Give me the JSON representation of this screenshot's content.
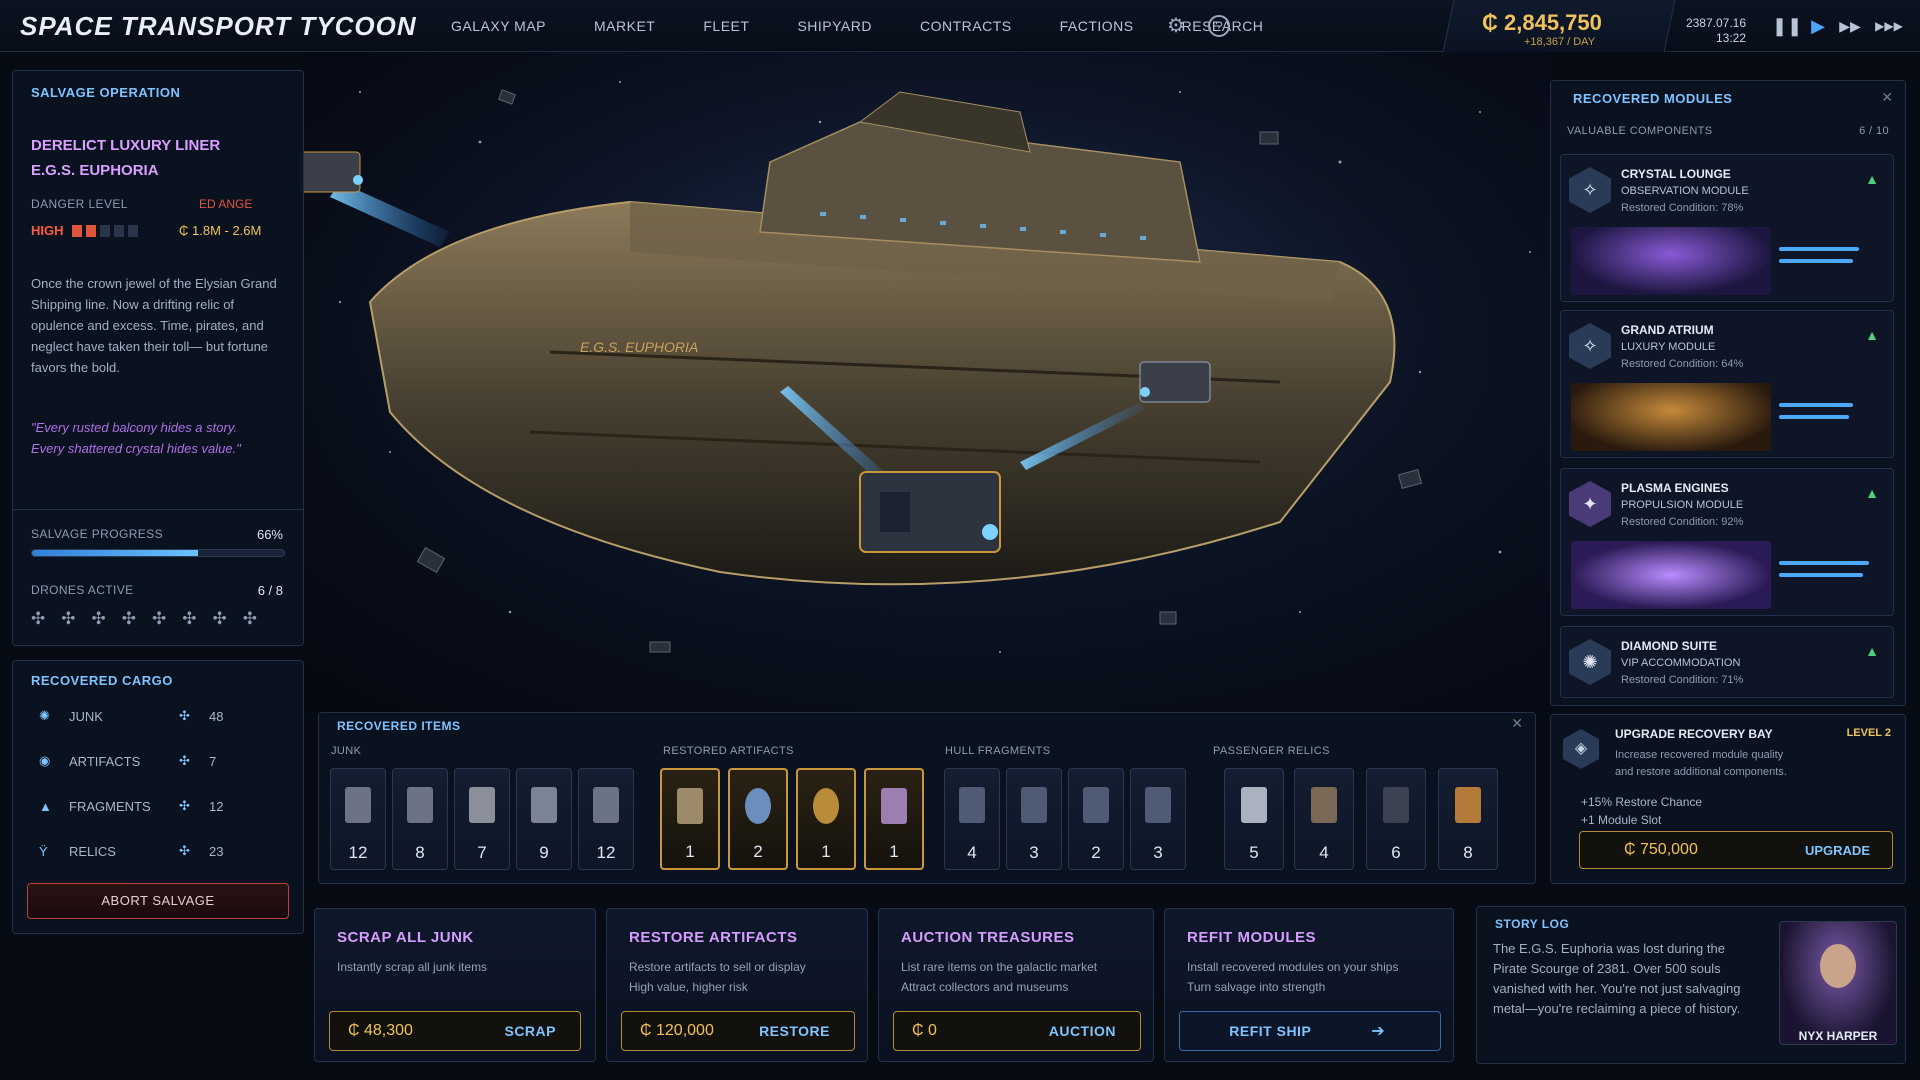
{
  "header": {
    "title": "SPACE TRANSPORT TYCOON",
    "nav": [
      "GALAXY MAP",
      "MARKET",
      "FLEET",
      "SHIPYARD",
      "CONTRACTS",
      "FACTIONS",
      "RESEARCH"
    ],
    "settings_icon": "gear-icon",
    "help_icon": "question-icon",
    "credits": "₵ 2,845,750",
    "income": "+18,367 / DAY",
    "date": "2387.07.16",
    "time": "13:22",
    "controls": [
      "pause-icon",
      "play-icon",
      "fast-forward-icon",
      "fastest-forward-icon"
    ]
  },
  "salvage": {
    "title": "SALVAGE OPERATION",
    "target_name": "DERELICT LUXURY LINER",
    "target_ship": "E.G.S. EUPHORIA",
    "danger_label": "DANGER LEVEL",
    "danger_value": "HIGH",
    "range_label": "ED ANGE",
    "range_value": "₵ 1.8M - 2.6M",
    "description": "Once the crown jewel of the Elysian Grand Shipping line. Now a drifting relic of opulence and excess. Time, pirates, and neglect have taken their toll— but fortune favors the bold.",
    "quote": "\"Every rusted balcony hides a story. Every shattered crystal hides value.\"",
    "progress_label": "SALVAGE PROGRESS",
    "progress_value": "66%",
    "progress_fraction": 0.66,
    "drones_label": "DRONES ACTIVE",
    "drones_value": "6 / 8"
  },
  "cargo": {
    "title": "RECOVERED CARGO",
    "rows": [
      {
        "label": "JUNK",
        "count": "48"
      },
      {
        "label": "ARTIFACTS",
        "count": "7"
      },
      {
        "label": "FRAGMENTS",
        "count": "12"
      },
      {
        "label": "RELICS",
        "count": "23"
      }
    ],
    "abort": "ABORT SALVAGE"
  },
  "items": {
    "title": "RECOVERED ITEMS",
    "groups": [
      "JUNK",
      "RESTORED ARTIFACTS",
      "HULL FRAGMENTS",
      "PASSENGER RELICS"
    ],
    "junk": [
      "12",
      "8",
      "7",
      "9",
      "12"
    ],
    "artifacts": [
      "1",
      "2",
      "1",
      "1"
    ],
    "hull": [
      "4",
      "3",
      "2",
      "3"
    ],
    "relics": [
      "5",
      "4",
      "6",
      "8"
    ]
  },
  "modules": {
    "title": "RECOVERED MODULES",
    "subtitle": "VALUABLE COMPONENTS",
    "count": "6 / 10",
    "list": [
      {
        "name": "CRYSTAL LOUNGE",
        "type": "OBSERVATION MODULE",
        "cond": "Restored Condition: 78%"
      },
      {
        "name": "GRAND ATRIUM",
        "type": "LUXURY MODULE",
        "cond": "Restored Condition: 64%"
      },
      {
        "name": "PLASMA ENGINES",
        "type": "PROPULSION MODULE",
        "cond": "Restored Condition: 92%"
      },
      {
        "name": "DIAMOND SUITE",
        "type": "VIP ACCOMMODATION",
        "cond": "Restored Condition: 71%"
      }
    ]
  },
  "upgrade": {
    "title": "UPGRADE RECOVERY BAY",
    "level": "LEVEL 2",
    "desc1": "Increase recovered module quality",
    "desc2": "and restore additional components.",
    "bonus1": "+15% Restore Chance",
    "bonus2": "+1 Module Slot",
    "cost": "₵ 750,000",
    "button": "UPGRADE"
  },
  "actions": [
    {
      "title": "SCRAP ALL JUNK",
      "d1": "Instantly scrap all junk items",
      "d2": "",
      "value": "₵ 48,300",
      "button": "SCRAP"
    },
    {
      "title": "RESTORE ARTIFACTS",
      "d1": "Restore artifacts to sell or display",
      "d2": "High value, higher risk",
      "value": "₵ 120,000",
      "button": "RESTORE"
    },
    {
      "title": "AUCTION TREASURES",
      "d1": "List rare items on the galactic market",
      "d2": "Attract collectors and museums",
      "value": "₵ 0",
      "button": "AUCTION"
    },
    {
      "title": "REFIT MODULES",
      "d1": "Install recovered modules on your ships",
      "d2": "Turn salvage into strength",
      "value": "",
      "button": "REFIT SHIP"
    }
  ],
  "story": {
    "title": "STORY LOG",
    "text": "The E.G.S. Euphoria was lost during the Pirate Scourge of 2381. Over 500 souls vanished with her. You're not just salvaging metal—you're reclaiming a piece of history.",
    "character": "NYX HARPER"
  },
  "scene": {
    "hull_text": "E.G.S. EUPHORIA"
  }
}
